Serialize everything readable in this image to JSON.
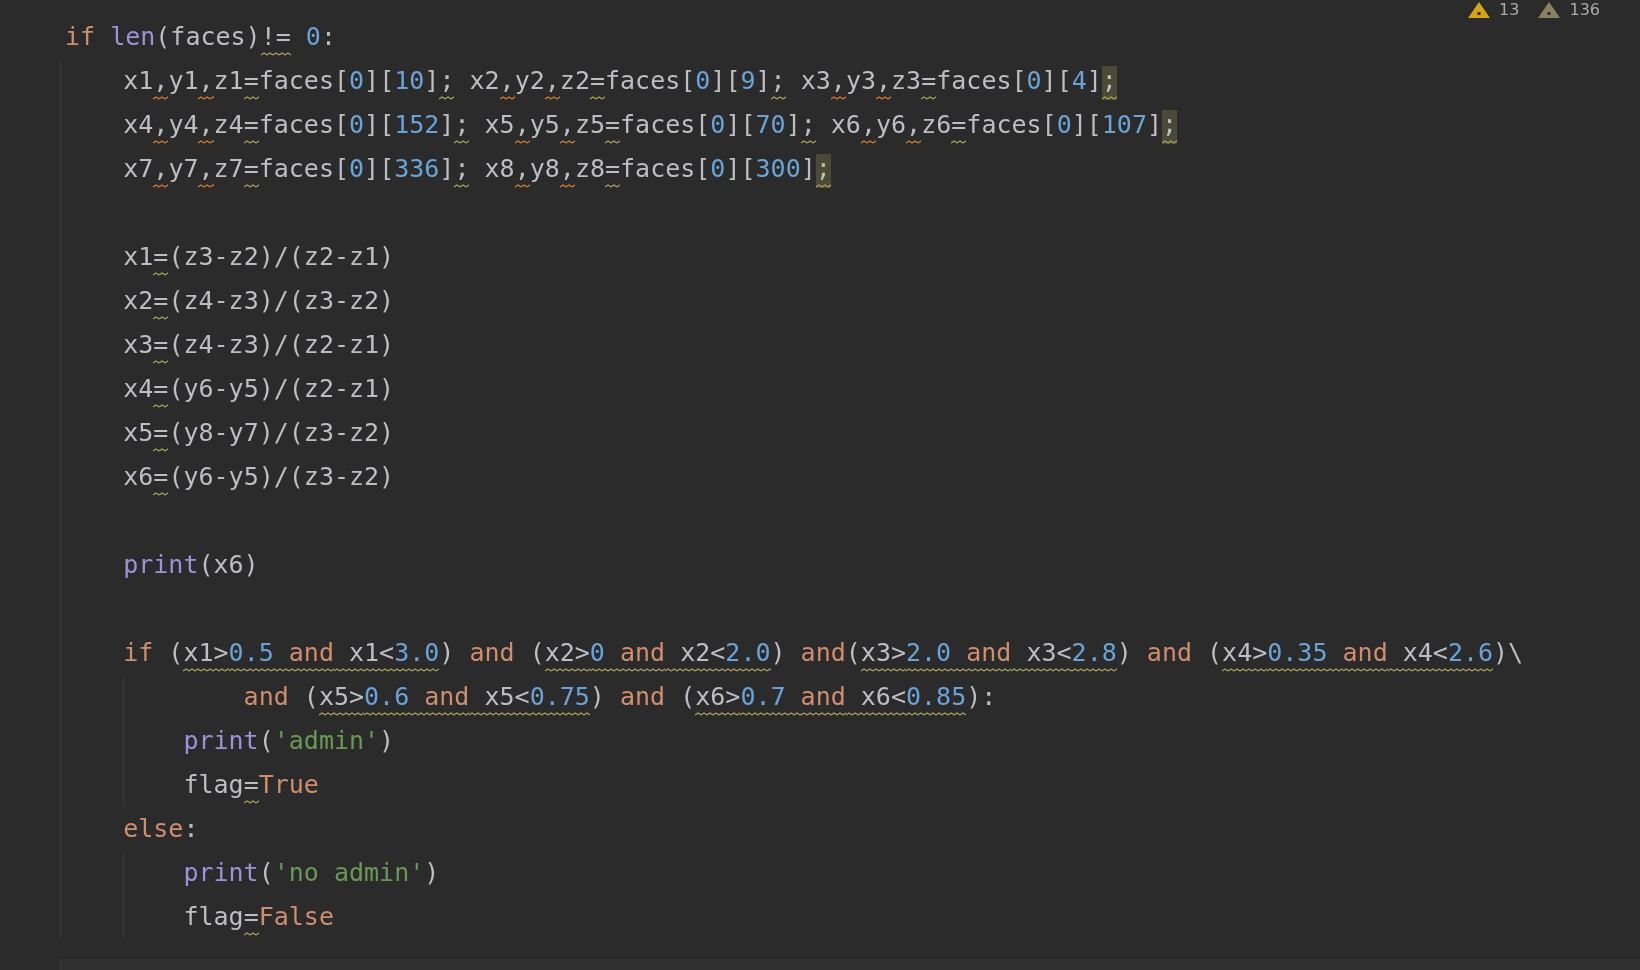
{
  "inspections": [
    {
      "kind": "warning",
      "count": "13"
    },
    {
      "kind": "weak",
      "count": "136"
    }
  ],
  "lines": [
    {
      "kind": "code",
      "tokens": [
        {
          "text": "if ",
          "kind": "kw",
          "warn": false
        },
        {
          "text": "len",
          "kind": "fn",
          "warn": false
        },
        {
          "text": "(faces)",
          "kind": "txt",
          "warn": false
        },
        {
          "text": "!=",
          "kind": "txt",
          "warn": true
        },
        {
          "text": " 0",
          "kind": "num",
          "warn": false
        },
        {
          "text": ":",
          "kind": "txt",
          "warn": false
        }
      ]
    },
    {
      "kind": "code",
      "tokens": [
        {
          "text": "    x1",
          "kind": "txt",
          "warn": false
        },
        {
          "text": ",",
          "kind": "punct",
          "warn": true
        },
        {
          "text": "y1",
          "kind": "txt",
          "warn": false
        },
        {
          "text": ",",
          "kind": "punct",
          "warn": true
        },
        {
          "text": "z1",
          "kind": "txt",
          "warn": false
        },
        {
          "text": "=",
          "kind": "txt",
          "warn": true
        },
        {
          "text": "faces[",
          "kind": "txt",
          "warn": false
        },
        {
          "text": "0",
          "kind": "num",
          "warn": false
        },
        {
          "text": "][",
          "kind": "txt",
          "warn": false
        },
        {
          "text": "10",
          "kind": "num",
          "warn": false
        },
        {
          "text": "]",
          "kind": "txt",
          "warn": false
        },
        {
          "text": ";",
          "kind": "txt",
          "warn": true
        },
        {
          "text": " x2",
          "kind": "txt",
          "warn": false
        },
        {
          "text": ",",
          "kind": "punct",
          "warn": true
        },
        {
          "text": "y2",
          "kind": "txt",
          "warn": false
        },
        {
          "text": ",",
          "kind": "punct",
          "warn": true
        },
        {
          "text": "z2",
          "kind": "txt",
          "warn": false
        },
        {
          "text": "=",
          "kind": "txt",
          "warn": true
        },
        {
          "text": "faces[",
          "kind": "txt",
          "warn": false
        },
        {
          "text": "0",
          "kind": "num",
          "warn": false
        },
        {
          "text": "][",
          "kind": "txt",
          "warn": false
        },
        {
          "text": "9",
          "kind": "num",
          "warn": false
        },
        {
          "text": "]",
          "kind": "txt",
          "warn": false
        },
        {
          "text": ";",
          "kind": "txt",
          "warn": true
        },
        {
          "text": " x3",
          "kind": "txt",
          "warn": false
        },
        {
          "text": ",",
          "kind": "punct",
          "warn": true
        },
        {
          "text": "y3",
          "kind": "txt",
          "warn": false
        },
        {
          "text": ",",
          "kind": "punct",
          "warn": true
        },
        {
          "text": "z3",
          "kind": "txt",
          "warn": false
        },
        {
          "text": "=",
          "kind": "txt",
          "warn": true
        },
        {
          "text": "faces[",
          "kind": "txt",
          "warn": false
        },
        {
          "text": "0",
          "kind": "num",
          "warn": false
        },
        {
          "text": "][",
          "kind": "txt",
          "warn": false
        },
        {
          "text": "4",
          "kind": "num",
          "warn": false
        },
        {
          "text": "]",
          "kind": "txt",
          "warn": false
        },
        {
          "text": ";",
          "kind": "flagged",
          "warn": true
        }
      ]
    },
    {
      "kind": "code",
      "tokens": [
        {
          "text": "    x4",
          "kind": "txt",
          "warn": false
        },
        {
          "text": ",",
          "kind": "punct",
          "warn": true
        },
        {
          "text": "y4",
          "kind": "txt",
          "warn": false
        },
        {
          "text": ",",
          "kind": "punct",
          "warn": true
        },
        {
          "text": "z4",
          "kind": "txt",
          "warn": false
        },
        {
          "text": "=",
          "kind": "txt",
          "warn": true
        },
        {
          "text": "faces[",
          "kind": "txt",
          "warn": false
        },
        {
          "text": "0",
          "kind": "num",
          "warn": false
        },
        {
          "text": "][",
          "kind": "txt",
          "warn": false
        },
        {
          "text": "152",
          "kind": "num",
          "warn": false
        },
        {
          "text": "]",
          "kind": "txt",
          "warn": false
        },
        {
          "text": ";",
          "kind": "txt",
          "warn": true
        },
        {
          "text": " x5",
          "kind": "txt",
          "warn": false
        },
        {
          "text": ",",
          "kind": "punct",
          "warn": true
        },
        {
          "text": "y5",
          "kind": "txt",
          "warn": false
        },
        {
          "text": ",",
          "kind": "punct",
          "warn": true
        },
        {
          "text": "z5",
          "kind": "txt",
          "warn": false
        },
        {
          "text": "=",
          "kind": "txt",
          "warn": true
        },
        {
          "text": "faces[",
          "kind": "txt",
          "warn": false
        },
        {
          "text": "0",
          "kind": "num",
          "warn": false
        },
        {
          "text": "][",
          "kind": "txt",
          "warn": false
        },
        {
          "text": "70",
          "kind": "num",
          "warn": false
        },
        {
          "text": "]",
          "kind": "txt",
          "warn": false
        },
        {
          "text": ";",
          "kind": "txt",
          "warn": true
        },
        {
          "text": " x6",
          "kind": "txt",
          "warn": false
        },
        {
          "text": ",",
          "kind": "punct",
          "warn": true
        },
        {
          "text": "y6",
          "kind": "txt",
          "warn": false
        },
        {
          "text": ",",
          "kind": "punct",
          "warn": true
        },
        {
          "text": "z6",
          "kind": "txt",
          "warn": false
        },
        {
          "text": "=",
          "kind": "txt",
          "warn": true
        },
        {
          "text": "faces[",
          "kind": "txt",
          "warn": false
        },
        {
          "text": "0",
          "kind": "num",
          "warn": false
        },
        {
          "text": "][",
          "kind": "txt",
          "warn": false
        },
        {
          "text": "107",
          "kind": "num",
          "warn": false
        },
        {
          "text": "]",
          "kind": "txt",
          "warn": false
        },
        {
          "text": ";",
          "kind": "flagged",
          "warn": true
        }
      ]
    },
    {
      "kind": "code",
      "tokens": [
        {
          "text": "    x7",
          "kind": "txt",
          "warn": false
        },
        {
          "text": ",",
          "kind": "punct",
          "warn": true
        },
        {
          "text": "y7",
          "kind": "txt",
          "warn": false
        },
        {
          "text": ",",
          "kind": "punct",
          "warn": true
        },
        {
          "text": "z7",
          "kind": "txt",
          "warn": false
        },
        {
          "text": "=",
          "kind": "txt",
          "warn": true
        },
        {
          "text": "faces[",
          "kind": "txt",
          "warn": false
        },
        {
          "text": "0",
          "kind": "num",
          "warn": false
        },
        {
          "text": "][",
          "kind": "txt",
          "warn": false
        },
        {
          "text": "336",
          "kind": "num",
          "warn": false
        },
        {
          "text": "]",
          "kind": "txt",
          "warn": false
        },
        {
          "text": ";",
          "kind": "txt",
          "warn": true
        },
        {
          "text": " x8",
          "kind": "txt",
          "warn": false
        },
        {
          "text": ",",
          "kind": "punct",
          "warn": true
        },
        {
          "text": "y8",
          "kind": "txt",
          "warn": false
        },
        {
          "text": ",",
          "kind": "punct",
          "warn": true
        },
        {
          "text": "z8",
          "kind": "txt",
          "warn": false
        },
        {
          "text": "=",
          "kind": "txt",
          "warn": true
        },
        {
          "text": "faces[",
          "kind": "txt",
          "warn": false
        },
        {
          "text": "0",
          "kind": "num",
          "warn": false
        },
        {
          "text": "][",
          "kind": "txt",
          "warn": false
        },
        {
          "text": "300",
          "kind": "num",
          "warn": false
        },
        {
          "text": "]",
          "kind": "txt",
          "warn": false
        },
        {
          "text": ";",
          "kind": "flagged",
          "warn": true
        }
      ]
    },
    {
      "kind": "blank"
    },
    {
      "kind": "code",
      "tokens": [
        {
          "text": "    x1",
          "kind": "txt",
          "warn": false
        },
        {
          "text": "=",
          "kind": "txt",
          "warn": true
        },
        {
          "text": "(z3-z2)/(z2-z1)",
          "kind": "txt",
          "warn": false
        }
      ]
    },
    {
      "kind": "code",
      "tokens": [
        {
          "text": "    x2",
          "kind": "txt",
          "warn": false
        },
        {
          "text": "=",
          "kind": "txt",
          "warn": true
        },
        {
          "text": "(z4-z3)/(z3-z2)",
          "kind": "txt",
          "warn": false
        }
      ]
    },
    {
      "kind": "code",
      "tokens": [
        {
          "text": "    x3",
          "kind": "txt",
          "warn": false
        },
        {
          "text": "=",
          "kind": "txt",
          "warn": true
        },
        {
          "text": "(z4-z3)/(z2-z1)",
          "kind": "txt",
          "warn": false
        }
      ]
    },
    {
      "kind": "code",
      "tokens": [
        {
          "text": "    x4",
          "kind": "txt",
          "warn": false
        },
        {
          "text": "=",
          "kind": "txt",
          "warn": true
        },
        {
          "text": "(y6-y5)/(z2-z1)",
          "kind": "txt",
          "warn": false
        }
      ]
    },
    {
      "kind": "code",
      "tokens": [
        {
          "text": "    x5",
          "kind": "txt",
          "warn": false
        },
        {
          "text": "=",
          "kind": "txt",
          "warn": true
        },
        {
          "text": "(y8-y7)/(z3-z2)",
          "kind": "txt",
          "warn": false
        }
      ]
    },
    {
      "kind": "code",
      "tokens": [
        {
          "text": "    x6",
          "kind": "txt",
          "warn": false
        },
        {
          "text": "=",
          "kind": "txt",
          "warn": true
        },
        {
          "text": "(y6-y5)/(z3-z2)",
          "kind": "txt",
          "warn": false
        }
      ]
    },
    {
      "kind": "blank"
    },
    {
      "kind": "code",
      "tokens": [
        {
          "text": "    print",
          "kind": "fn",
          "warn": false
        },
        {
          "text": "(x6)",
          "kind": "txt",
          "warn": false
        }
      ]
    },
    {
      "kind": "blank"
    },
    {
      "kind": "code",
      "tokens": [
        {
          "text": "    if",
          "kind": "kw",
          "warn": false
        },
        {
          "text": " (",
          "kind": "txt",
          "warn": false
        },
        {
          "text": "x1>",
          "kind": "txt",
          "warn": true
        },
        {
          "text": "0.5 ",
          "kind": "num",
          "warn": true
        },
        {
          "text": "and",
          "kind": "kw",
          "warn": true
        },
        {
          "text": " x1<",
          "kind": "txt",
          "warn": true
        },
        {
          "text": "3.0",
          "kind": "num",
          "warn": true
        },
        {
          "text": ") ",
          "kind": "txt",
          "warn": false
        },
        {
          "text": "and",
          "kind": "kw",
          "warn": false
        },
        {
          "text": " (",
          "kind": "txt",
          "warn": false
        },
        {
          "text": "x2>",
          "kind": "txt",
          "warn": true
        },
        {
          "text": "0 ",
          "kind": "num",
          "warn": true
        },
        {
          "text": "and",
          "kind": "kw",
          "warn": true
        },
        {
          "text": " x2<",
          "kind": "txt",
          "warn": true
        },
        {
          "text": "2.0",
          "kind": "num",
          "warn": true
        },
        {
          "text": ") ",
          "kind": "txt",
          "warn": false
        },
        {
          "text": "and",
          "kind": "kw",
          "warn": false
        },
        {
          "text": "(",
          "kind": "txt",
          "warn": false
        },
        {
          "text": "x3>",
          "kind": "txt",
          "warn": true
        },
        {
          "text": "2.0 ",
          "kind": "num",
          "warn": true
        },
        {
          "text": "and",
          "kind": "kw",
          "warn": true
        },
        {
          "text": " x3<",
          "kind": "txt",
          "warn": true
        },
        {
          "text": "2.8",
          "kind": "num",
          "warn": true
        },
        {
          "text": ") ",
          "kind": "txt",
          "warn": false
        },
        {
          "text": "and",
          "kind": "kw",
          "warn": false
        },
        {
          "text": " (",
          "kind": "txt",
          "warn": false
        },
        {
          "text": "x4>",
          "kind": "txt",
          "warn": true
        },
        {
          "text": "0.35 ",
          "kind": "num",
          "warn": true
        },
        {
          "text": "and",
          "kind": "kw",
          "warn": true
        },
        {
          "text": " x4<",
          "kind": "txt",
          "warn": true
        },
        {
          "text": "2.6",
          "kind": "num",
          "warn": true
        },
        {
          "text": ")\\",
          "kind": "txt",
          "warn": false
        }
      ]
    },
    {
      "kind": "code",
      "tokens": [
        {
          "text": "            and",
          "kind": "kw",
          "warn": false
        },
        {
          "text": " (",
          "kind": "txt",
          "warn": false
        },
        {
          "text": "x5>",
          "kind": "txt",
          "warn": true
        },
        {
          "text": "0.6 ",
          "kind": "num",
          "warn": true
        },
        {
          "text": "and",
          "kind": "kw",
          "warn": true
        },
        {
          "text": " x5<",
          "kind": "txt",
          "warn": true
        },
        {
          "text": "0.75",
          "kind": "num",
          "warn": true
        },
        {
          "text": ") ",
          "kind": "txt",
          "warn": false
        },
        {
          "text": "and",
          "kind": "kw",
          "warn": false
        },
        {
          "text": " (",
          "kind": "txt",
          "warn": false
        },
        {
          "text": "x6>",
          "kind": "txt",
          "warn": true
        },
        {
          "text": "0.7 ",
          "kind": "num",
          "warn": true
        },
        {
          "text": "and",
          "kind": "kw",
          "warn": true
        },
        {
          "text": " x6<",
          "kind": "txt",
          "warn": true
        },
        {
          "text": "0.85",
          "kind": "num",
          "warn": true
        },
        {
          "text": "):",
          "kind": "txt",
          "warn": false
        }
      ]
    },
    {
      "kind": "code",
      "tokens": [
        {
          "text": "        print",
          "kind": "fn",
          "warn": false
        },
        {
          "text": "(",
          "kind": "txt",
          "warn": false
        },
        {
          "text": "'admin'",
          "kind": "str",
          "warn": false
        },
        {
          "text": ")",
          "kind": "txt",
          "warn": false
        }
      ]
    },
    {
      "kind": "code",
      "tokens": [
        {
          "text": "        flag",
          "kind": "txt",
          "warn": false
        },
        {
          "text": "=",
          "kind": "txt",
          "warn": true
        },
        {
          "text": "True",
          "kind": "kw",
          "warn": false
        }
      ]
    },
    {
      "kind": "code",
      "tokens": [
        {
          "text": "    else",
          "kind": "kw",
          "warn": false
        },
        {
          "text": ":",
          "kind": "txt",
          "warn": false
        }
      ]
    },
    {
      "kind": "code",
      "tokens": [
        {
          "text": "        print",
          "kind": "fn",
          "warn": false
        },
        {
          "text": "(",
          "kind": "txt",
          "warn": false
        },
        {
          "text": "'no admin'",
          "kind": "str",
          "warn": false
        },
        {
          "text": ")",
          "kind": "txt",
          "warn": false
        }
      ]
    },
    {
      "kind": "code",
      "tokens": [
        {
          "text": "        flag",
          "kind": "txt",
          "warn": false
        },
        {
          "text": "=",
          "kind": "txt",
          "warn": true
        },
        {
          "text": "False",
          "kind": "kw",
          "warn": false
        }
      ]
    }
  ]
}
